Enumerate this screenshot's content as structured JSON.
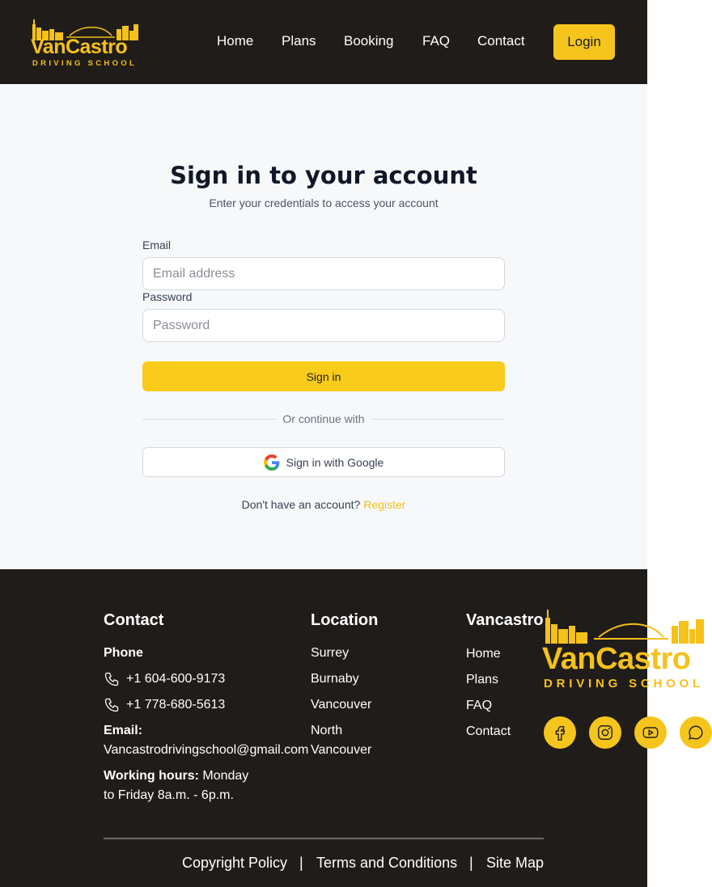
{
  "brand": {
    "name": "VanCastro",
    "tagline": "DRIVING SCHOOL"
  },
  "nav": {
    "items": [
      "Home",
      "Plans",
      "Booking",
      "FAQ",
      "Contact"
    ],
    "login_label": "Login"
  },
  "signin": {
    "title": "Sign in to your account",
    "subtitle": "Enter your credentials to access your account",
    "email_label": "Email",
    "email_placeholder": "Email address",
    "email_value": "",
    "password_label": "Password",
    "password_placeholder": "Password",
    "password_value": "",
    "submit_label": "Sign in",
    "divider_text": "Or continue with",
    "google_label": "Sign in with Google",
    "register_prompt": "Don't have an account?",
    "register_link": "Register"
  },
  "footer": {
    "contact": {
      "heading": "Contact",
      "phone_label": "Phone",
      "phones": [
        "+1 604-600-9173",
        "+1 778-680-5613"
      ],
      "email_label": "Email:",
      "email": "Vancastrodrivingschool@gmail.com",
      "hours_label": "Working hours:",
      "hours_line1": "Monday",
      "hours_line2": "to Friday 8a.m. - 6p.m."
    },
    "location": {
      "heading": "Location",
      "items": [
        "Surrey",
        "Burnaby",
        "Vancouver",
        "North",
        "Vancouver"
      ]
    },
    "links": {
      "heading": "Vancastro",
      "items": [
        "Home",
        "Plans",
        "FAQ",
        "Contact"
      ]
    },
    "legal": [
      "Copyright Policy",
      "Terms and Conditions",
      "Site Map"
    ],
    "legal_separator": "|"
  },
  "social": [
    "facebook-icon",
    "instagram-icon",
    "youtube-icon",
    "chat-icon"
  ],
  "colors": {
    "accent": "#f6c51d",
    "dark": "#201c1a",
    "main_bg": "#f6f8fa",
    "link": "#f5c11a"
  }
}
